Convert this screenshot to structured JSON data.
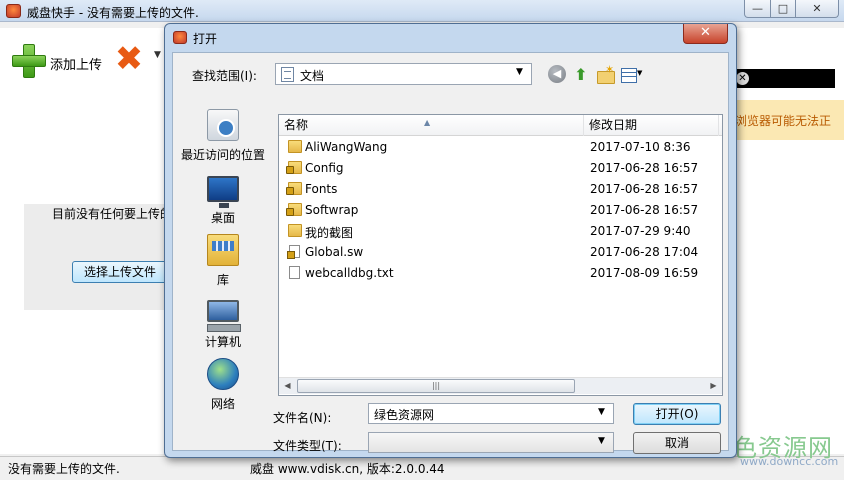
{
  "app": {
    "title": "威盘快手 - 没有需要上传的文件.",
    "window_buttons": {
      "minimize": "—",
      "maximize": "□",
      "close": "✕"
    },
    "toolbar": {
      "add_upload_label": "添加上传",
      "delete_caret": "▼"
    },
    "empty_message": "目前没有任何要上传的",
    "choose_file_label": "选择上传文件",
    "warning_text": "浏览器可能无法正",
    "status_left": "没有需要上传的文件.",
    "status_center": "威盘 www.vdisk.cn, 版本:2.0.0.44",
    "close_x": "✕"
  },
  "watermark": {
    "text": "绿色资源网",
    "url": "www.downcc.com"
  },
  "dialog": {
    "title": "打开",
    "close_label": "✕",
    "look_in_label": "查找范围(I):",
    "look_in_value": "文档",
    "places": [
      {
        "label": "最近访问的位置",
        "icon": "recent-places-icon"
      },
      {
        "label": "桌面",
        "icon": "desktop-icon"
      },
      {
        "label": "库",
        "icon": "libraries-icon"
      },
      {
        "label": "计算机",
        "icon": "computer-icon"
      },
      {
        "label": "网络",
        "icon": "network-icon"
      }
    ],
    "columns": {
      "name": "名称",
      "date": "修改日期"
    },
    "files": [
      {
        "name": "AliWangWang",
        "date": "2017-07-10 8:36",
        "extra": "",
        "icon": "folder-icon"
      },
      {
        "name": "Config",
        "date": "2017-06-28 16:57",
        "extra": "",
        "icon": "locked-folder-icon"
      },
      {
        "name": "Fonts",
        "date": "2017-06-28 16:57",
        "extra": "",
        "icon": "locked-folder-icon"
      },
      {
        "name": "Softwrap",
        "date": "2017-06-28 16:57",
        "extra": "",
        "icon": "locked-folder-icon"
      },
      {
        "name": "我的截图",
        "date": "2017-07-29 9:40",
        "extra": "",
        "icon": "folder-icon"
      },
      {
        "name": "Global.sw",
        "date": "2017-06-28 17:04",
        "extra": "",
        "icon": "locked-file-icon"
      },
      {
        "name": "webcalldbg.txt",
        "date": "2017-08-09 16:59",
        "extra": "",
        "icon": "text-file-icon"
      }
    ],
    "file_name_label": "文件名(N):",
    "file_name_value": "绿色资源网",
    "file_type_label": "文件类型(T):",
    "file_type_value": "",
    "open_label": "打开(O)",
    "cancel_label": "取消"
  }
}
